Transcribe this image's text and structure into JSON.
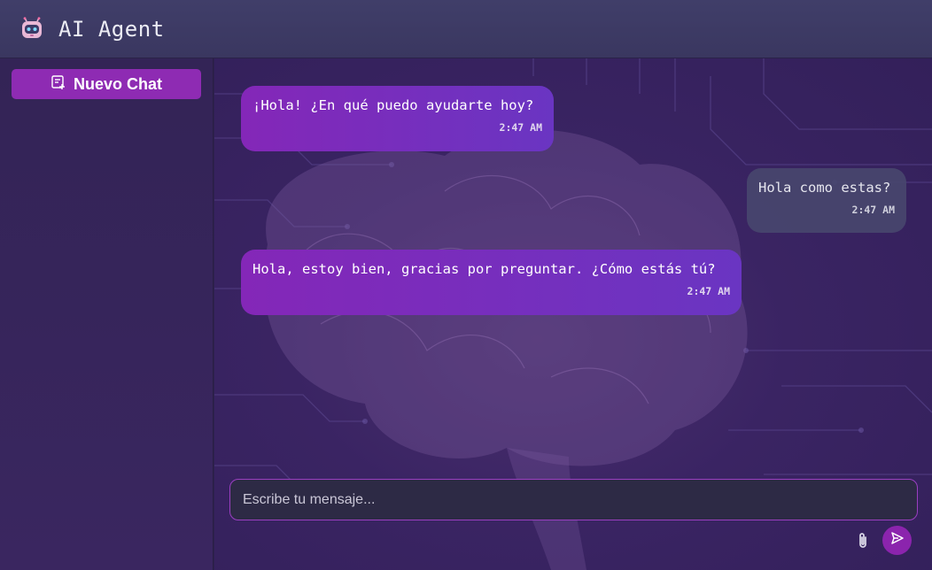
{
  "header": {
    "title": "AI Agent",
    "icon": "robot-icon"
  },
  "sidebar": {
    "new_chat_label": "Nuevo Chat",
    "new_chat_icon": "new-chat-icon"
  },
  "messages": [
    {
      "role": "bot",
      "text": "¡Hola! ¿En qué puedo ayudarte hoy?",
      "time": "2:47 AM"
    },
    {
      "role": "user",
      "text": "Hola como estas?",
      "time": "2:47 AM"
    },
    {
      "role": "bot",
      "text": "Hola, estoy bien, gracias por preguntar. ¿Cómo estás tú?",
      "time": "2:47 AM"
    }
  ],
  "composer": {
    "placeholder": "Escribe tu mensaje...",
    "value": "",
    "attach_icon": "paperclip-icon",
    "send_icon": "send-icon"
  },
  "colors": {
    "accent": "#8e2bb3",
    "bot_bubble": "#7a2dbd",
    "user_bubble": "#48466e",
    "background": "#33205a"
  }
}
